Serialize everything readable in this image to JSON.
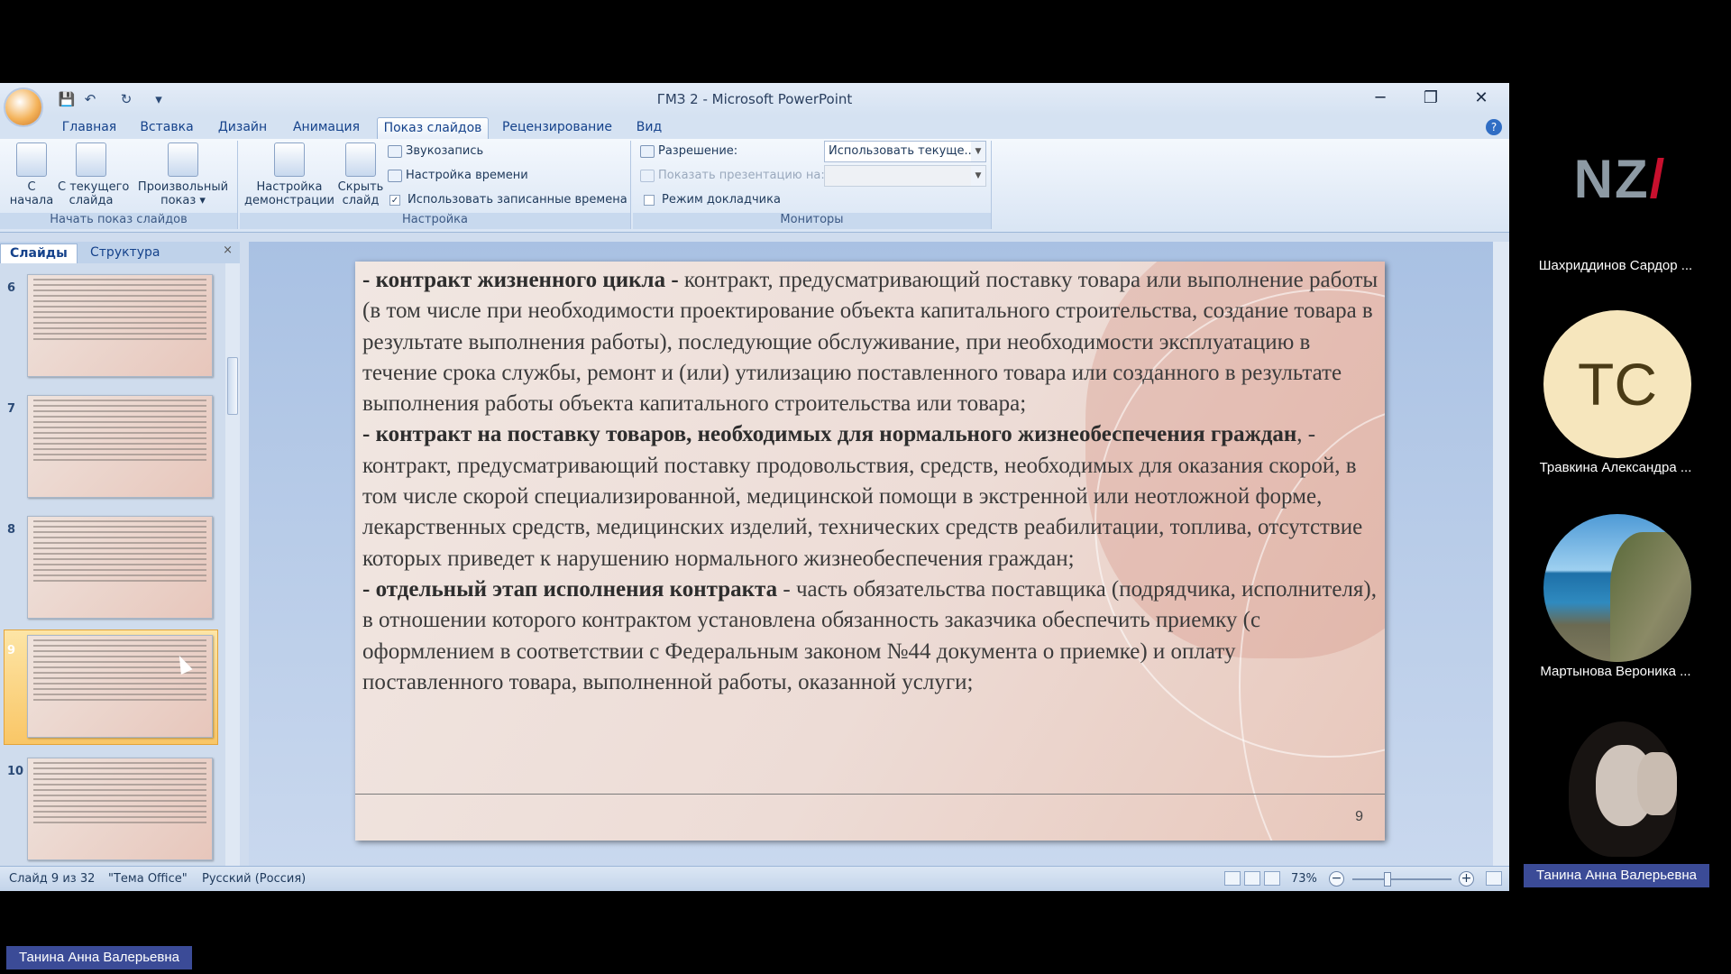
{
  "window": {
    "title": "ГМЗ 2 - Microsoft PowerPoint",
    "minimize": "─",
    "restore": "❐",
    "close": "✕"
  },
  "qat": {
    "save": "💾",
    "undo": "↶",
    "redo": "↻",
    "customize": "▾"
  },
  "ribbon_tabs": [
    "Главная",
    "Вставка",
    "Дизайн",
    "Анимация",
    "Показ слайдов",
    "Рецензирование",
    "Вид"
  ],
  "active_tab": "Показ слайдов",
  "help_icon": "?",
  "ribbon": {
    "start_group": {
      "label": "Начать показ слайдов",
      "from_beginning": "С\nначала",
      "from_current": "С текущего\nслайда",
      "custom_show": "Произвольный\nпоказ ▾"
    },
    "setup_group": {
      "label": "Настройка",
      "setup_show": "Настройка\nдемонстрации",
      "hide_slide": "Скрыть\nслайд",
      "record_narration": "Звукозапись",
      "rehearse_timings": "Настройка времени",
      "use_timings": "Использовать записанные времена",
      "use_timings_checked": "✓"
    },
    "monitors_group": {
      "label": "Мониторы",
      "resolution_label": "Разрешение:",
      "resolution_value": "Использовать текуще...",
      "show_on_label": "Показать презентацию на:",
      "show_on_value": "",
      "presenter_view": "Режим докладчика"
    }
  },
  "panel": {
    "tab_slides": "Слайды",
    "tab_outline": "Структура",
    "close": "×",
    "thumbnails": [
      "6",
      "7",
      "8",
      "9",
      "10"
    ],
    "selected": "9"
  },
  "slide": {
    "term1": "- контракт жизненного цикла -",
    "text1": " контракт, предусматривающий поставку товара или выполнение работы (в том числе при необходимости проектирование объекта капитального строительства, создание товара в результате выполнения работы), последующие обслуживание, при необходимости эксплуатацию в течение срока службы, ремонт и (или) утилизацию поставленного товара или созданного в результате выполнения работы объекта капитального строительства или товара;",
    "term2": "- контракт на поставку товаров, необходимых для нормального жизнеобеспечения граждан",
    "text2": ", - контракт, предусматривающий поставку продовольствия, средств, необходимых для оказания скорой, в том числе скорой специализированной, медицинской помощи в экстренной или неотложной форме, лекарственных средств, медицинских изделий, технических средств реабилитации, топлива, отсутствие которых приведет к нарушению нормального жизнеобеспечения граждан;",
    "term3": "- отдельный этап исполнения контракта",
    "text3": " - часть обязательства поставщика (подрядчика, исполнителя), в отношении которого контрактом установлена обязанность заказчика обеспечить приемку (с оформлением в соответствии с Федеральным законом №44 документа о приемке) и оплату поставленного товара, выполненной работы, оказанной услуги;",
    "number": "9"
  },
  "status": {
    "slide_counter": "Слайд 9 из 32",
    "theme": "\"Тема Office\"",
    "language": "Русский (Россия)",
    "zoom": "73%",
    "zoom_minus": "−",
    "zoom_plus": "+"
  },
  "participants": [
    {
      "name": "Шахриддинов Сардор ...",
      "initials": "",
      "logo": "NZ"
    },
    {
      "name": "Травкина Александра ...",
      "initials": "TC"
    },
    {
      "name": "Мартынова Вероника ..."
    },
    {
      "name": "Танина Анна Валерьевна"
    }
  ],
  "bottom_badge": "Танина Анна Валерьевна",
  "colors": {
    "accent": "#3b4b97",
    "ribbon": "#d5e2f2",
    "slide_bg": "#eddcd6"
  }
}
